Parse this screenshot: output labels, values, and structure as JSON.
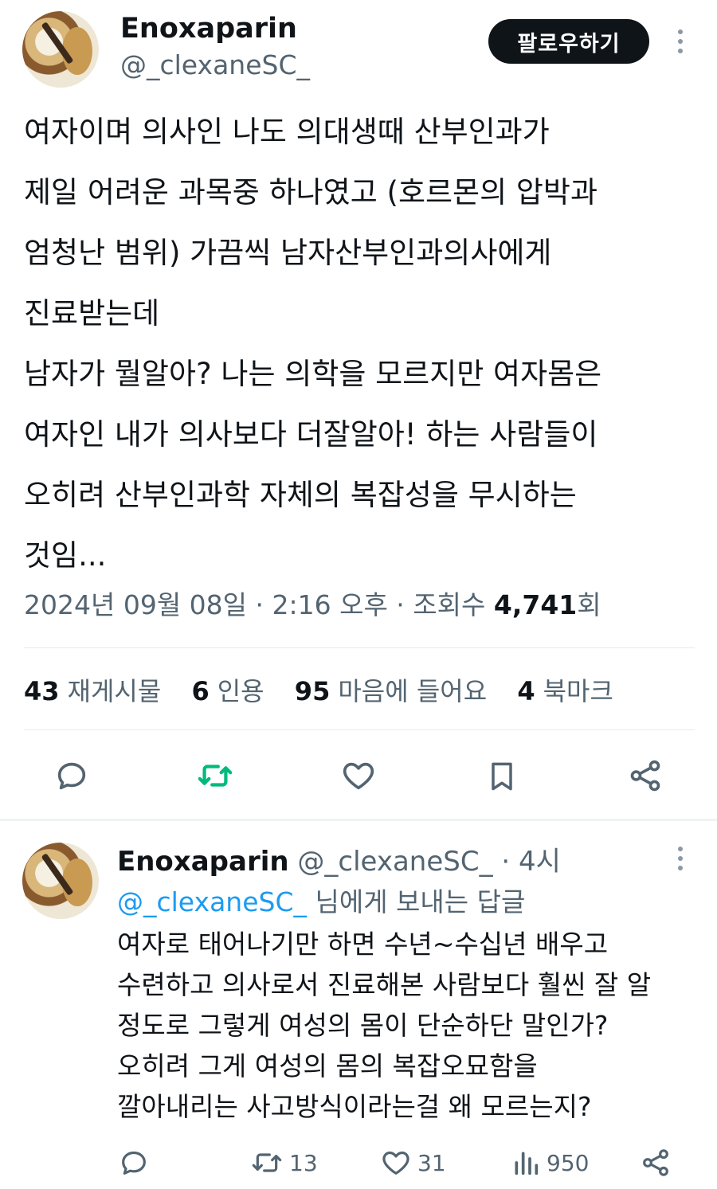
{
  "tweet": {
    "author_name": "Enoxaparin",
    "author_handle": "@_clexaneSC_",
    "follow_label": "팔로우하기",
    "text": "여자이며 의사인 나도 의대생때 산부인과가\n제일 어려운 과목중 하나였고 (호르몬의 압박과\n엄청난 범위) 가끔씩 남자산부인과의사에게\n진료받는데\n남자가 뭘알아? 나는 의학을 모르지만 여자몸은\n여자인 내가 의사보다 더잘알아! 하는 사람들이\n오히려 산부인과학 자체의 복잡성을 무시하는\n것임...",
    "meta": {
      "datetime": "2024년 09월 08일 · 2:16 오후 · 조회수 ",
      "views": "4,741",
      "views_suffix": "회"
    },
    "stats": [
      {
        "count": "43",
        "label": "재게시물"
      },
      {
        "count": "6",
        "label": "인용"
      },
      {
        "count": "95",
        "label": "마음에 들어요"
      },
      {
        "count": "4",
        "label": "북마크"
      }
    ],
    "actions": [
      {
        "icon": "reply-icon"
      },
      {
        "icon": "repost-icon",
        "color": "#00ba7c"
      },
      {
        "icon": "like-icon"
      },
      {
        "icon": "bookmark-icon"
      },
      {
        "icon": "share-icon"
      }
    ]
  },
  "reply": {
    "author_name": "Enoxaparin",
    "author_handle": "@_clexaneSC_",
    "time": "· 4시",
    "replying_mention": "@_clexaneSC_",
    "replying_suffix": " 님에게 보내는 답글",
    "text": "여자로 태어나기만 하면 수년~수십년 배우고\n수련하고 의사로서 진료해본 사람보다 훨씬 잘 알\n정도로 그렇게 여성의 몸이 단순하단 말인가?\n오히려 그게 여성의 몸의 복잡오묘함을\n깔아내리는 사고방식이라는걸 왜 모르는지?",
    "actions": [
      {
        "icon": "reply-icon",
        "count": ""
      },
      {
        "icon": "repost-icon",
        "count": "13"
      },
      {
        "icon": "like-icon",
        "count": "31"
      },
      {
        "icon": "views-icon",
        "count": "950"
      },
      {
        "icon": "share-icon",
        "count": ""
      }
    ]
  },
  "colors": {
    "text": "#0f1419",
    "secondary": "#536471",
    "link": "#1d9bf0",
    "repost_green": "#00ba7c"
  }
}
